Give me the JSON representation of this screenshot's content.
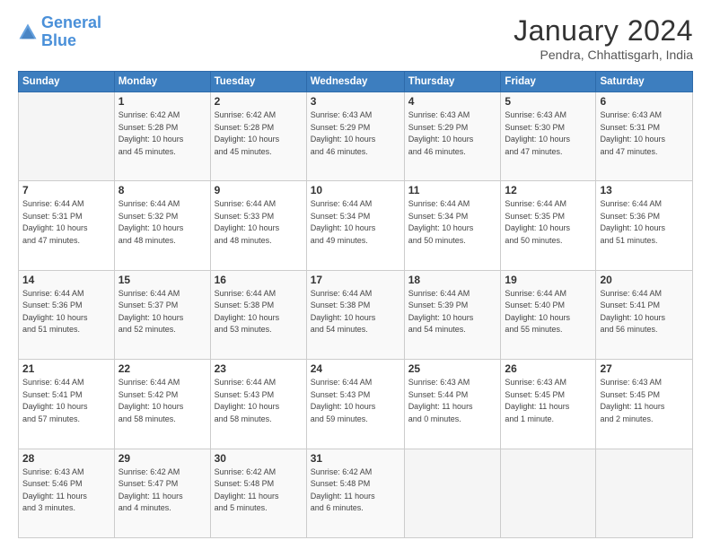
{
  "logo": {
    "line1": "General",
    "line2": "Blue"
  },
  "title": "January 2024",
  "subtitle": "Pendra, Chhattisgarh, India",
  "days_header": [
    "Sunday",
    "Monday",
    "Tuesday",
    "Wednesday",
    "Thursday",
    "Friday",
    "Saturday"
  ],
  "weeks": [
    [
      {
        "day": "",
        "info": ""
      },
      {
        "day": "1",
        "info": "Sunrise: 6:42 AM\nSunset: 5:28 PM\nDaylight: 10 hours\nand 45 minutes."
      },
      {
        "day": "2",
        "info": "Sunrise: 6:42 AM\nSunset: 5:28 PM\nDaylight: 10 hours\nand 45 minutes."
      },
      {
        "day": "3",
        "info": "Sunrise: 6:43 AM\nSunset: 5:29 PM\nDaylight: 10 hours\nand 46 minutes."
      },
      {
        "day": "4",
        "info": "Sunrise: 6:43 AM\nSunset: 5:29 PM\nDaylight: 10 hours\nand 46 minutes."
      },
      {
        "day": "5",
        "info": "Sunrise: 6:43 AM\nSunset: 5:30 PM\nDaylight: 10 hours\nand 47 minutes."
      },
      {
        "day": "6",
        "info": "Sunrise: 6:43 AM\nSunset: 5:31 PM\nDaylight: 10 hours\nand 47 minutes."
      }
    ],
    [
      {
        "day": "7",
        "info": "Sunrise: 6:44 AM\nSunset: 5:31 PM\nDaylight: 10 hours\nand 47 minutes."
      },
      {
        "day": "8",
        "info": "Sunrise: 6:44 AM\nSunset: 5:32 PM\nDaylight: 10 hours\nand 48 minutes."
      },
      {
        "day": "9",
        "info": "Sunrise: 6:44 AM\nSunset: 5:33 PM\nDaylight: 10 hours\nand 48 minutes."
      },
      {
        "day": "10",
        "info": "Sunrise: 6:44 AM\nSunset: 5:34 PM\nDaylight: 10 hours\nand 49 minutes."
      },
      {
        "day": "11",
        "info": "Sunrise: 6:44 AM\nSunset: 5:34 PM\nDaylight: 10 hours\nand 50 minutes."
      },
      {
        "day": "12",
        "info": "Sunrise: 6:44 AM\nSunset: 5:35 PM\nDaylight: 10 hours\nand 50 minutes."
      },
      {
        "day": "13",
        "info": "Sunrise: 6:44 AM\nSunset: 5:36 PM\nDaylight: 10 hours\nand 51 minutes."
      }
    ],
    [
      {
        "day": "14",
        "info": "Sunrise: 6:44 AM\nSunset: 5:36 PM\nDaylight: 10 hours\nand 51 minutes."
      },
      {
        "day": "15",
        "info": "Sunrise: 6:44 AM\nSunset: 5:37 PM\nDaylight: 10 hours\nand 52 minutes."
      },
      {
        "day": "16",
        "info": "Sunrise: 6:44 AM\nSunset: 5:38 PM\nDaylight: 10 hours\nand 53 minutes."
      },
      {
        "day": "17",
        "info": "Sunrise: 6:44 AM\nSunset: 5:38 PM\nDaylight: 10 hours\nand 54 minutes."
      },
      {
        "day": "18",
        "info": "Sunrise: 6:44 AM\nSunset: 5:39 PM\nDaylight: 10 hours\nand 54 minutes."
      },
      {
        "day": "19",
        "info": "Sunrise: 6:44 AM\nSunset: 5:40 PM\nDaylight: 10 hours\nand 55 minutes."
      },
      {
        "day": "20",
        "info": "Sunrise: 6:44 AM\nSunset: 5:41 PM\nDaylight: 10 hours\nand 56 minutes."
      }
    ],
    [
      {
        "day": "21",
        "info": "Sunrise: 6:44 AM\nSunset: 5:41 PM\nDaylight: 10 hours\nand 57 minutes."
      },
      {
        "day": "22",
        "info": "Sunrise: 6:44 AM\nSunset: 5:42 PM\nDaylight: 10 hours\nand 58 minutes."
      },
      {
        "day": "23",
        "info": "Sunrise: 6:44 AM\nSunset: 5:43 PM\nDaylight: 10 hours\nand 58 minutes."
      },
      {
        "day": "24",
        "info": "Sunrise: 6:44 AM\nSunset: 5:43 PM\nDaylight: 10 hours\nand 59 minutes."
      },
      {
        "day": "25",
        "info": "Sunrise: 6:43 AM\nSunset: 5:44 PM\nDaylight: 11 hours\nand 0 minutes."
      },
      {
        "day": "26",
        "info": "Sunrise: 6:43 AM\nSunset: 5:45 PM\nDaylight: 11 hours\nand 1 minute."
      },
      {
        "day": "27",
        "info": "Sunrise: 6:43 AM\nSunset: 5:45 PM\nDaylight: 11 hours\nand 2 minutes."
      }
    ],
    [
      {
        "day": "28",
        "info": "Sunrise: 6:43 AM\nSunset: 5:46 PM\nDaylight: 11 hours\nand 3 minutes."
      },
      {
        "day": "29",
        "info": "Sunrise: 6:42 AM\nSunset: 5:47 PM\nDaylight: 11 hours\nand 4 minutes."
      },
      {
        "day": "30",
        "info": "Sunrise: 6:42 AM\nSunset: 5:48 PM\nDaylight: 11 hours\nand 5 minutes."
      },
      {
        "day": "31",
        "info": "Sunrise: 6:42 AM\nSunset: 5:48 PM\nDaylight: 11 hours\nand 6 minutes."
      },
      {
        "day": "",
        "info": ""
      },
      {
        "day": "",
        "info": ""
      },
      {
        "day": "",
        "info": ""
      }
    ]
  ]
}
